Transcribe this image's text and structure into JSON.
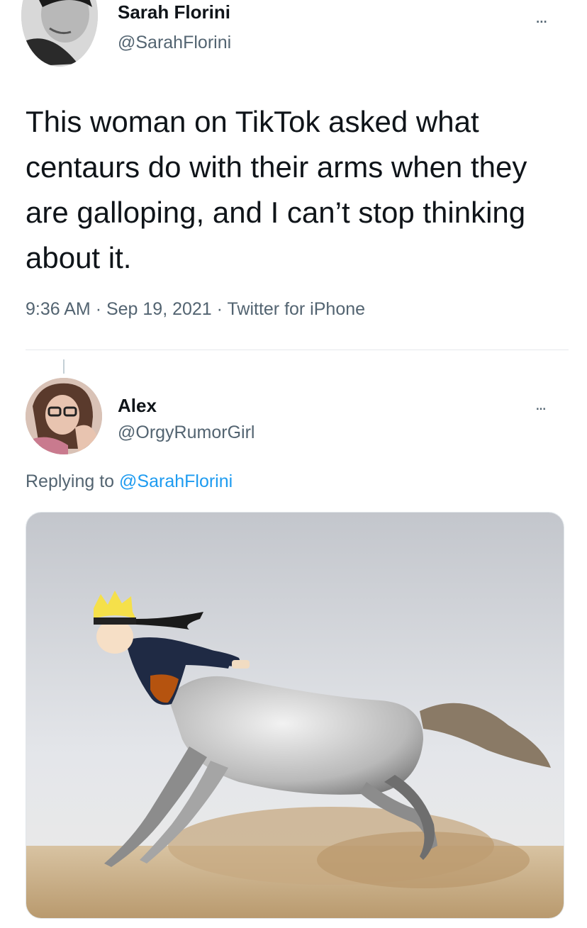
{
  "tweet": {
    "author_name": "Sarah Florini",
    "author_handle": "@SarahFlorini",
    "more_label": "...",
    "text": "This woman on TikTok asked what centaurs do with their arms when they are galloping, and I can’t stop thinking about it.",
    "time": "9:36 AM",
    "date": "Sep 19, 2021",
    "source": "Twitter for iPhone",
    "separator": "·"
  },
  "reply": {
    "author_name": "Alex",
    "author_handle": "@OrgyRumorGirl",
    "more_label": "...",
    "replying_prefix": "Replying to",
    "replying_handle": "@SarahFlorini"
  },
  "colors": {
    "text": "#0f1419",
    "secondary": "#536471",
    "link": "#1d9bf0"
  },
  "media": {
    "description_icon": "centaur-image"
  }
}
